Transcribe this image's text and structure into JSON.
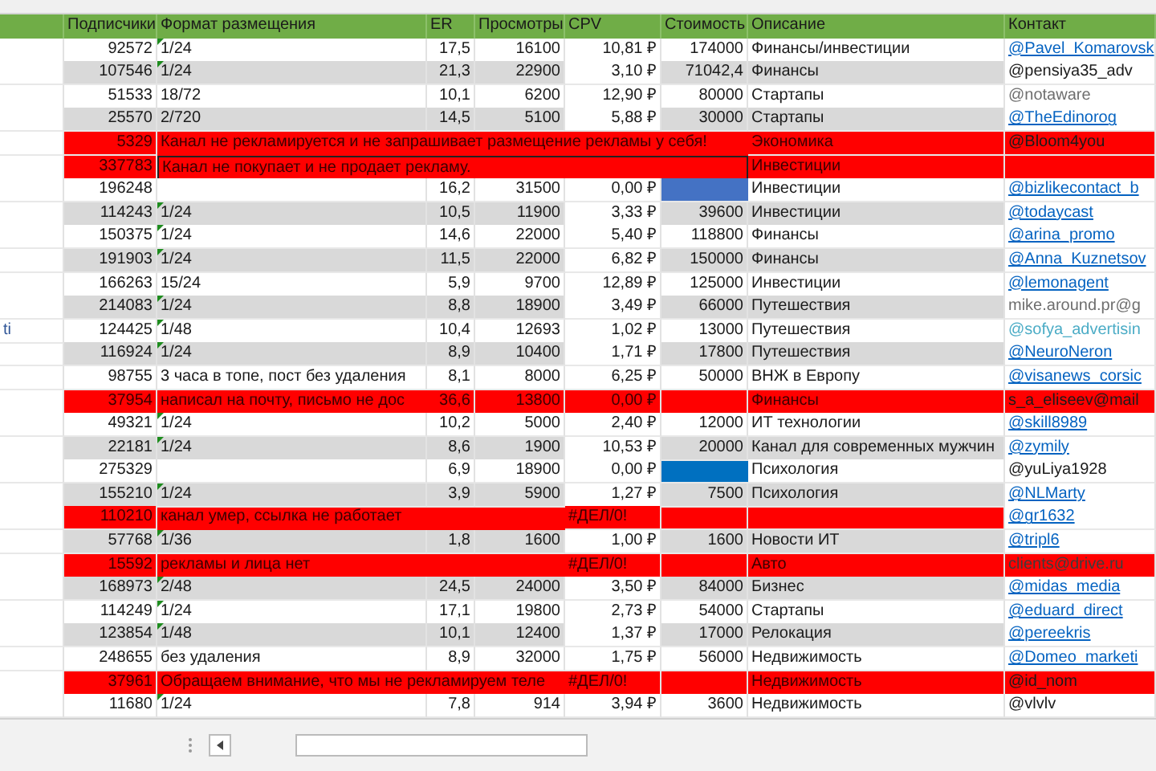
{
  "table": {
    "columns": [
      "",
      "Подписчики",
      "Формат размещения",
      "ER",
      "Просмотры",
      "CPV",
      "Стоимость",
      "Описание",
      "Контакт"
    ],
    "rows": [
      {
        "kind": "normal",
        "subscribers": "92572",
        "format": "1/24",
        "note": true,
        "er": "17,5",
        "views": "16100",
        "cpv": "10,81 ₽",
        "cost": "174000",
        "description": "Финансы/инвестиции",
        "contact": {
          "text": "@Pavel_Komarovsk",
          "kind": "link"
        }
      },
      {
        "kind": "normal",
        "subscribers": "107546",
        "format": "1/24",
        "note": true,
        "er": "21,3",
        "views": "22900",
        "cpv": "3,10 ₽",
        "cost": "71042,4",
        "description": "Финансы",
        "contact": {
          "text": "@pensiya35_adv",
          "kind": "plain"
        }
      },
      {
        "kind": "normal",
        "subscribers": "51533",
        "format": "18/72",
        "note": false,
        "er": "10,1",
        "views": "6200",
        "cpv": "12,90 ₽",
        "cost": "80000",
        "description": "Стартапы",
        "contact": {
          "text": "@notaware",
          "kind": "muted"
        }
      },
      {
        "kind": "normal",
        "subscribers": "25570",
        "format": "2/720",
        "note": false,
        "er": "14,5",
        "views": "5100",
        "cpv": "5,88 ₽",
        "cost": "30000",
        "description": "Стартапы",
        "contact": {
          "text": "@TheEdinorog",
          "kind": "link"
        }
      },
      {
        "kind": "error",
        "subscribers": "5329",
        "message": "Канал не рекламируется и не запрашивает размещение рекламы у себя!",
        "boxed": false,
        "description": "Экономика",
        "contact": {
          "text": "@Bloom4you",
          "kind": "plain"
        }
      },
      {
        "kind": "error",
        "subscribers": "337783",
        "message": "Канал не покупает и не продает рекламу.",
        "boxed": true,
        "description": "Инвестиции"
      },
      {
        "kind": "normal",
        "subscribers": "196248",
        "note": false,
        "er": "16,2",
        "views": "31500",
        "cpv": "0,00 ₽",
        "color": "#4472c4",
        "description": "Инвестиции",
        "contact": {
          "text": "@bizlikecontact_b",
          "kind": "link"
        }
      },
      {
        "kind": "normal",
        "subscribers": "114243",
        "format": "1/24",
        "note": true,
        "er": "10,5",
        "views": "11900",
        "cpv": "3,33 ₽",
        "cost": "39600",
        "description": "Инвестиции",
        "contact": {
          "text": "@todaycast",
          "kind": "link"
        }
      },
      {
        "kind": "normal",
        "subscribers": "150375",
        "format": "1/24",
        "note": true,
        "er": "14,6",
        "views": "22000",
        "cpv": "5,40 ₽",
        "cost": "118800",
        "description": "Финансы",
        "contact": {
          "text": "@arina_promo",
          "kind": "link"
        }
      },
      {
        "kind": "normal",
        "subscribers": "191903",
        "format": "1/24",
        "note": true,
        "er": "11,5",
        "views": "22000",
        "cpv": "6,82 ₽",
        "cost": "150000",
        "description": "Финансы",
        "contact": {
          "text": "@Anna_Kuznetsov",
          "kind": "link"
        }
      },
      {
        "kind": "normal",
        "subscribers": "166263",
        "format": "15/24",
        "note": false,
        "er": "5,9",
        "views": "9700",
        "cpv": "12,89 ₽",
        "cost": "125000",
        "description": "Инвестиции",
        "contact": {
          "text": "@lemonagent",
          "kind": "link"
        }
      },
      {
        "kind": "normal",
        "subscribers": "214083",
        "format": "1/24",
        "note": true,
        "er": "8,8",
        "views": "18900",
        "cpv": "3,49 ₽",
        "cost": "66000",
        "description": "Путешествия",
        "contact": {
          "text": "mike.around.pr@g",
          "kind": "muted"
        }
      },
      {
        "kind": "normal",
        "column_1": "ti",
        "subscribers": "124425",
        "format": "1/48",
        "note": true,
        "er": "10,4",
        "views": "12693",
        "cpv": "1,02 ₽",
        "cost": "13000",
        "description": "Путешествия",
        "contact": {
          "text": "@sofya_advertisin",
          "kind": "light"
        }
      },
      {
        "kind": "normal",
        "subscribers": "116924",
        "format": "1/24",
        "note": true,
        "er": "8,9",
        "views": "10400",
        "cpv": "1,71 ₽",
        "cost": "17800",
        "description": "Путешествия",
        "contact": {
          "text": "@NeuroNeron",
          "kind": "link"
        }
      },
      {
        "kind": "normal",
        "subscribers": "98755",
        "format": "3 часа в топе, пост без удаления",
        "note": false,
        "er": "8,1",
        "views": "8000",
        "cpv": "6,25 ₽",
        "cost": "50000",
        "description": "ВНЖ в Европу",
        "contact": {
          "text": "@visanews_corsic",
          "kind": "link"
        }
      },
      {
        "kind": "error",
        "subscribers": "37954",
        "message": "написал на почту, письмо не дос",
        "boxed": false,
        "er": "36,6",
        "views": "13800",
        "cpv": "0,00 ₽",
        "description": "Финансы",
        "contact": {
          "text": "s_a_eliseev@mail",
          "kind": "plain"
        }
      },
      {
        "kind": "normal",
        "subscribers": "49321",
        "format": "1/24",
        "note": true,
        "er": "10,2",
        "views": "5000",
        "cpv": "2,40 ₽",
        "cost": "12000",
        "description": "ИТ технологии",
        "contact": {
          "text": "@skill8989",
          "kind": "link"
        }
      },
      {
        "kind": "normal",
        "subscribers": "22181",
        "format": "1/24",
        "note": true,
        "er": "8,6",
        "views": "1900",
        "cpv": "10,53 ₽",
        "cost": "20000",
        "description": "Канал для современных мужчин",
        "contact": {
          "text": "@zymily",
          "kind": "link"
        }
      },
      {
        "kind": "normal",
        "subscribers": "275329",
        "note": false,
        "er": "6,9",
        "views": "18900",
        "cpv": "0,00 ₽",
        "color": "#0070c0",
        "description": "Психология",
        "contact": {
          "text": "@yuLiya1928",
          "kind": "plain"
        }
      },
      {
        "kind": "normal",
        "subscribers": "155210",
        "format": "1/24",
        "note": true,
        "er": "3,9",
        "views": "5900",
        "cpv": "1,27 ₽",
        "cost": "7500",
        "description": "Психология",
        "contact": {
          "text": "@NLMarty",
          "kind": "link"
        }
      },
      {
        "kind": "error",
        "subscribers": "110210",
        "message": "канал умер, ссылка не работает",
        "boxed": false,
        "cpv": "#ДЕЛ/0!",
        "contact": {
          "text": "@gr1632",
          "kind": "link"
        }
      },
      {
        "kind": "normal",
        "subscribers": "57768",
        "format": "1/36",
        "note": true,
        "er": "1,8",
        "views": "1600",
        "cpv": "1,00 ₽",
        "cost": "1600",
        "description": "Новости ИТ",
        "contact": {
          "text": "@tripl6",
          "kind": "link"
        }
      },
      {
        "kind": "error",
        "subscribers": "15592",
        "message": "рекламы и лица нет",
        "boxed": false,
        "cpv": "#ДЕЛ/0!",
        "description": "Авто",
        "contact": {
          "text": "clients@drive.ru",
          "kind": "muted"
        }
      },
      {
        "kind": "normal",
        "subscribers": "168973",
        "format": "2/48",
        "note": true,
        "er": "24,5",
        "views": "24000",
        "cpv": "3,50 ₽",
        "cost": "84000",
        "description": "Бизнес",
        "contact": {
          "text": "@midas_media",
          "kind": "link"
        }
      },
      {
        "kind": "normal",
        "subscribers": "114249",
        "format": "1/24",
        "note": true,
        "er": "17,1",
        "views": "19800",
        "cpv": "2,73 ₽",
        "cost": "54000",
        "description": "Стартапы",
        "contact": {
          "text": "@eduard_direct",
          "kind": "link"
        }
      },
      {
        "kind": "normal",
        "subscribers": "123854",
        "format": "1/48",
        "note": true,
        "er": "10,1",
        "views": "12400",
        "cpv": "1,37 ₽",
        "cost": "17000",
        "description": "Релокация",
        "contact": {
          "text": "@pereekris",
          "kind": "link"
        }
      },
      {
        "kind": "normal",
        "subscribers": "248655",
        "format": "без удаления",
        "note": false,
        "er": "8,9",
        "views": "32000",
        "cpv": "1,75 ₽",
        "cost": "56000",
        "description": "Недвижимость",
        "contact": {
          "text": "@Domeo_marketi",
          "kind": "link"
        }
      },
      {
        "kind": "error",
        "subscribers": "37961",
        "message": "Обращаем внимание, что мы не рекламируем теле",
        "boxed": false,
        "cpv": "#ДЕЛ/0!",
        "description": "Недвижимость",
        "contact": {
          "text": "@id_nom",
          "kind": "plain"
        }
      },
      {
        "kind": "normal",
        "subscribers": "11680",
        "format": "1/24",
        "note": true,
        "er": "7,8",
        "views": "914",
        "cpv": "3,94 ₽",
        "cost": "3600",
        "description": "Недвижимость",
        "contact": {
          "text": "@vlvlv",
          "kind": "plain"
        }
      }
    ]
  }
}
